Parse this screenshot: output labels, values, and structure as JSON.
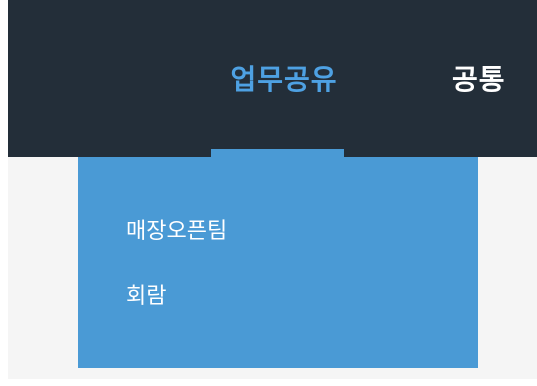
{
  "header": {
    "active_menu": "업무공유",
    "next_menu": "공통"
  },
  "dropdown": {
    "items": [
      {
        "label": "매장오픈팀"
      },
      {
        "label": "회람"
      }
    ]
  },
  "colors": {
    "header_background": "#232e39",
    "accent": "#4ea1e3",
    "dropdown_background": "#4a9ad5",
    "text_light": "#ffffff",
    "page_background": "#f5f5f5"
  }
}
